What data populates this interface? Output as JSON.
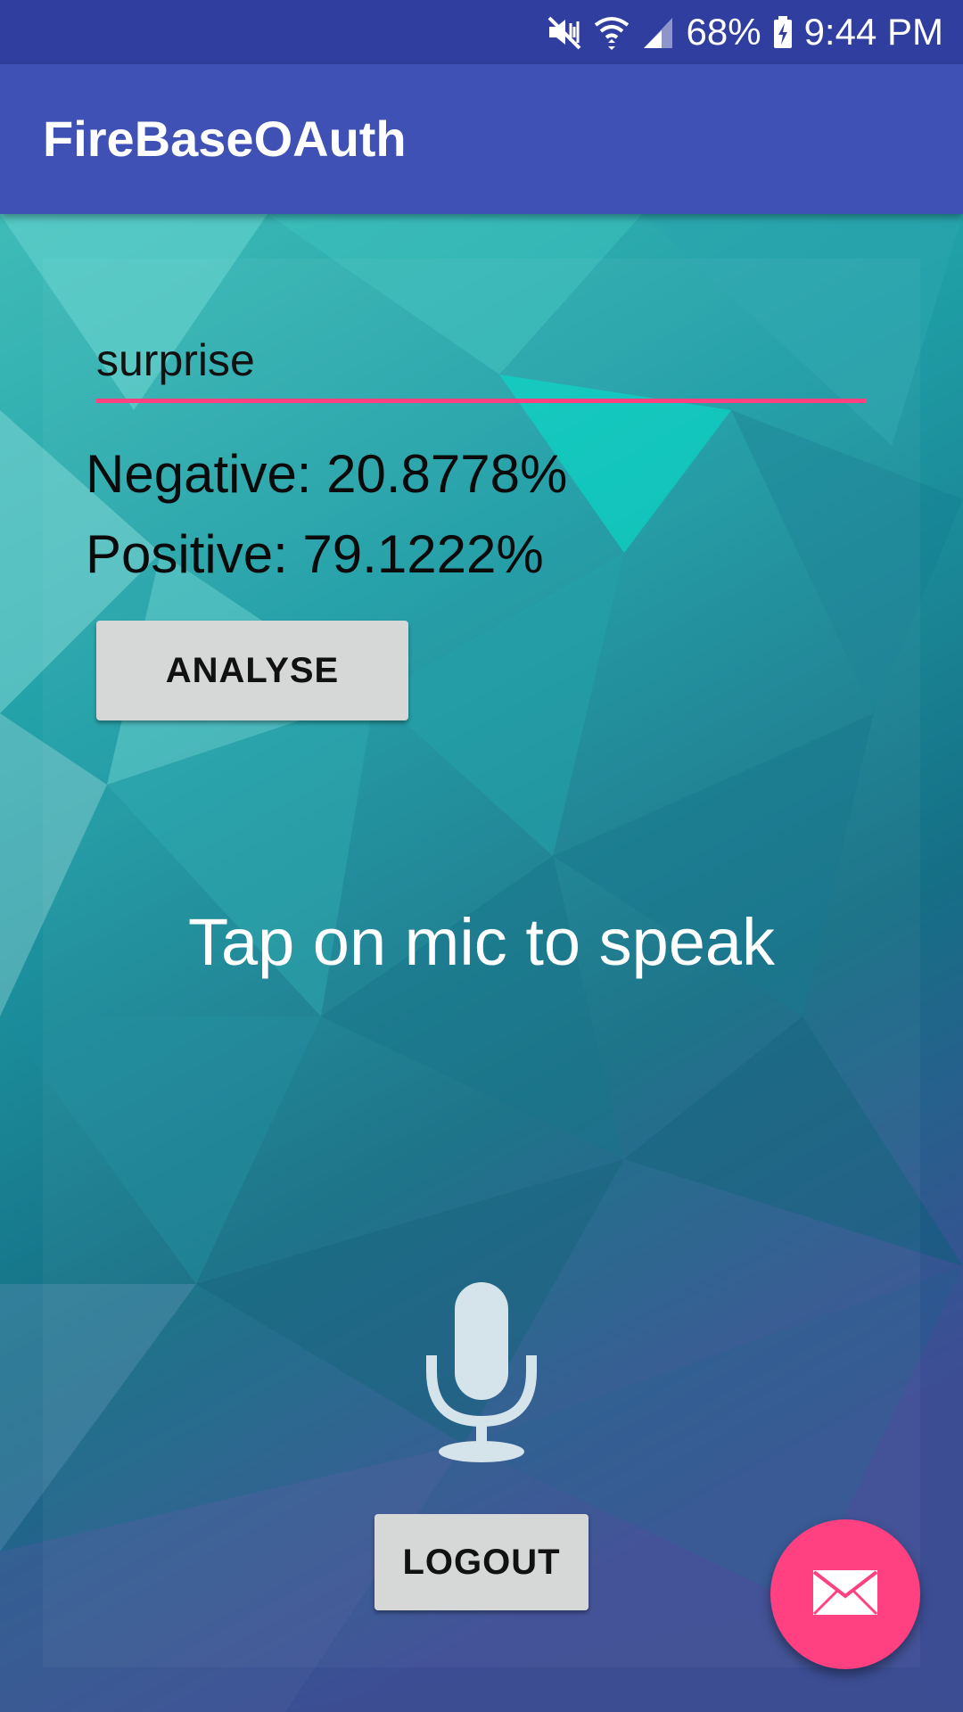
{
  "status_bar": {
    "battery": "68%",
    "time": "9:44 PM",
    "icons": [
      "mute-vibrate-icon",
      "wifi-icon",
      "signal-icon",
      "battery-charging-icon"
    ]
  },
  "app_bar": {
    "title": "FireBaseOAuth"
  },
  "main": {
    "input_value": "surprise",
    "negative": "Negative: 20.8778%",
    "positive": "Positive: 79.1222%",
    "analyse_label": "ANALYSE",
    "hint": "Tap on mic to speak",
    "mic_icon": "microphone-icon",
    "logout_label": "LOGOUT"
  },
  "fab": {
    "icon": "mail-icon"
  },
  "colors": {
    "status_bar": "#303f9f",
    "app_bar": "#3f51b5",
    "accent": "#ff4081",
    "button": "#d6d7d7"
  }
}
